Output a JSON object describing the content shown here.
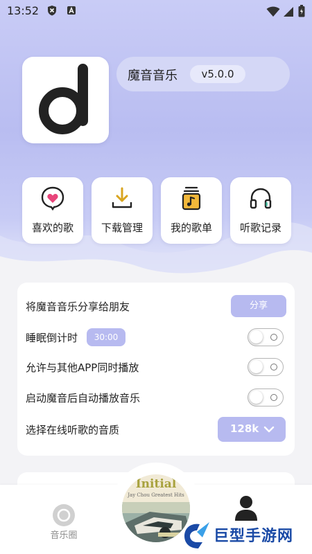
{
  "status_bar": {
    "time": "13:52",
    "left_icons": [
      "shield-icon",
      "keyboard-a-icon"
    ],
    "right_icons": [
      "wifi-icon",
      "signal-icon",
      "battery-icon"
    ]
  },
  "header": {
    "app_name": "魔音音乐",
    "version": "v5.0.0"
  },
  "quick_actions": [
    {
      "label": "喜欢的歌",
      "icon": "heart-icon"
    },
    {
      "label": "下载管理",
      "icon": "download-icon"
    },
    {
      "label": "我的歌单",
      "icon": "playlist-icon"
    },
    {
      "label": "听歌记录",
      "icon": "headphones-icon"
    }
  ],
  "settings": {
    "share": {
      "label": "将魔音音乐分享给朋友",
      "button": "分享"
    },
    "sleep_timer": {
      "label": "睡眠倒计时",
      "value": "30:00"
    },
    "mix_play": {
      "label": "允许与其他APP同时播放",
      "enabled": false
    },
    "autoplay": {
      "label": "启动魔音后自动播放音乐",
      "enabled": false
    },
    "quality": {
      "label": "选择在线听歌的音质",
      "value": "128k"
    }
  },
  "bottom_nav": {
    "left_label": "音乐圈",
    "album_title": "Initial",
    "album_subtitle": "Jay Chou Greatest Hits"
  },
  "watermark": {
    "text": "巨型手游网"
  },
  "colors": {
    "accent": "#b7baf0",
    "header_bg": "#c2c5f4",
    "text": "#222222"
  }
}
